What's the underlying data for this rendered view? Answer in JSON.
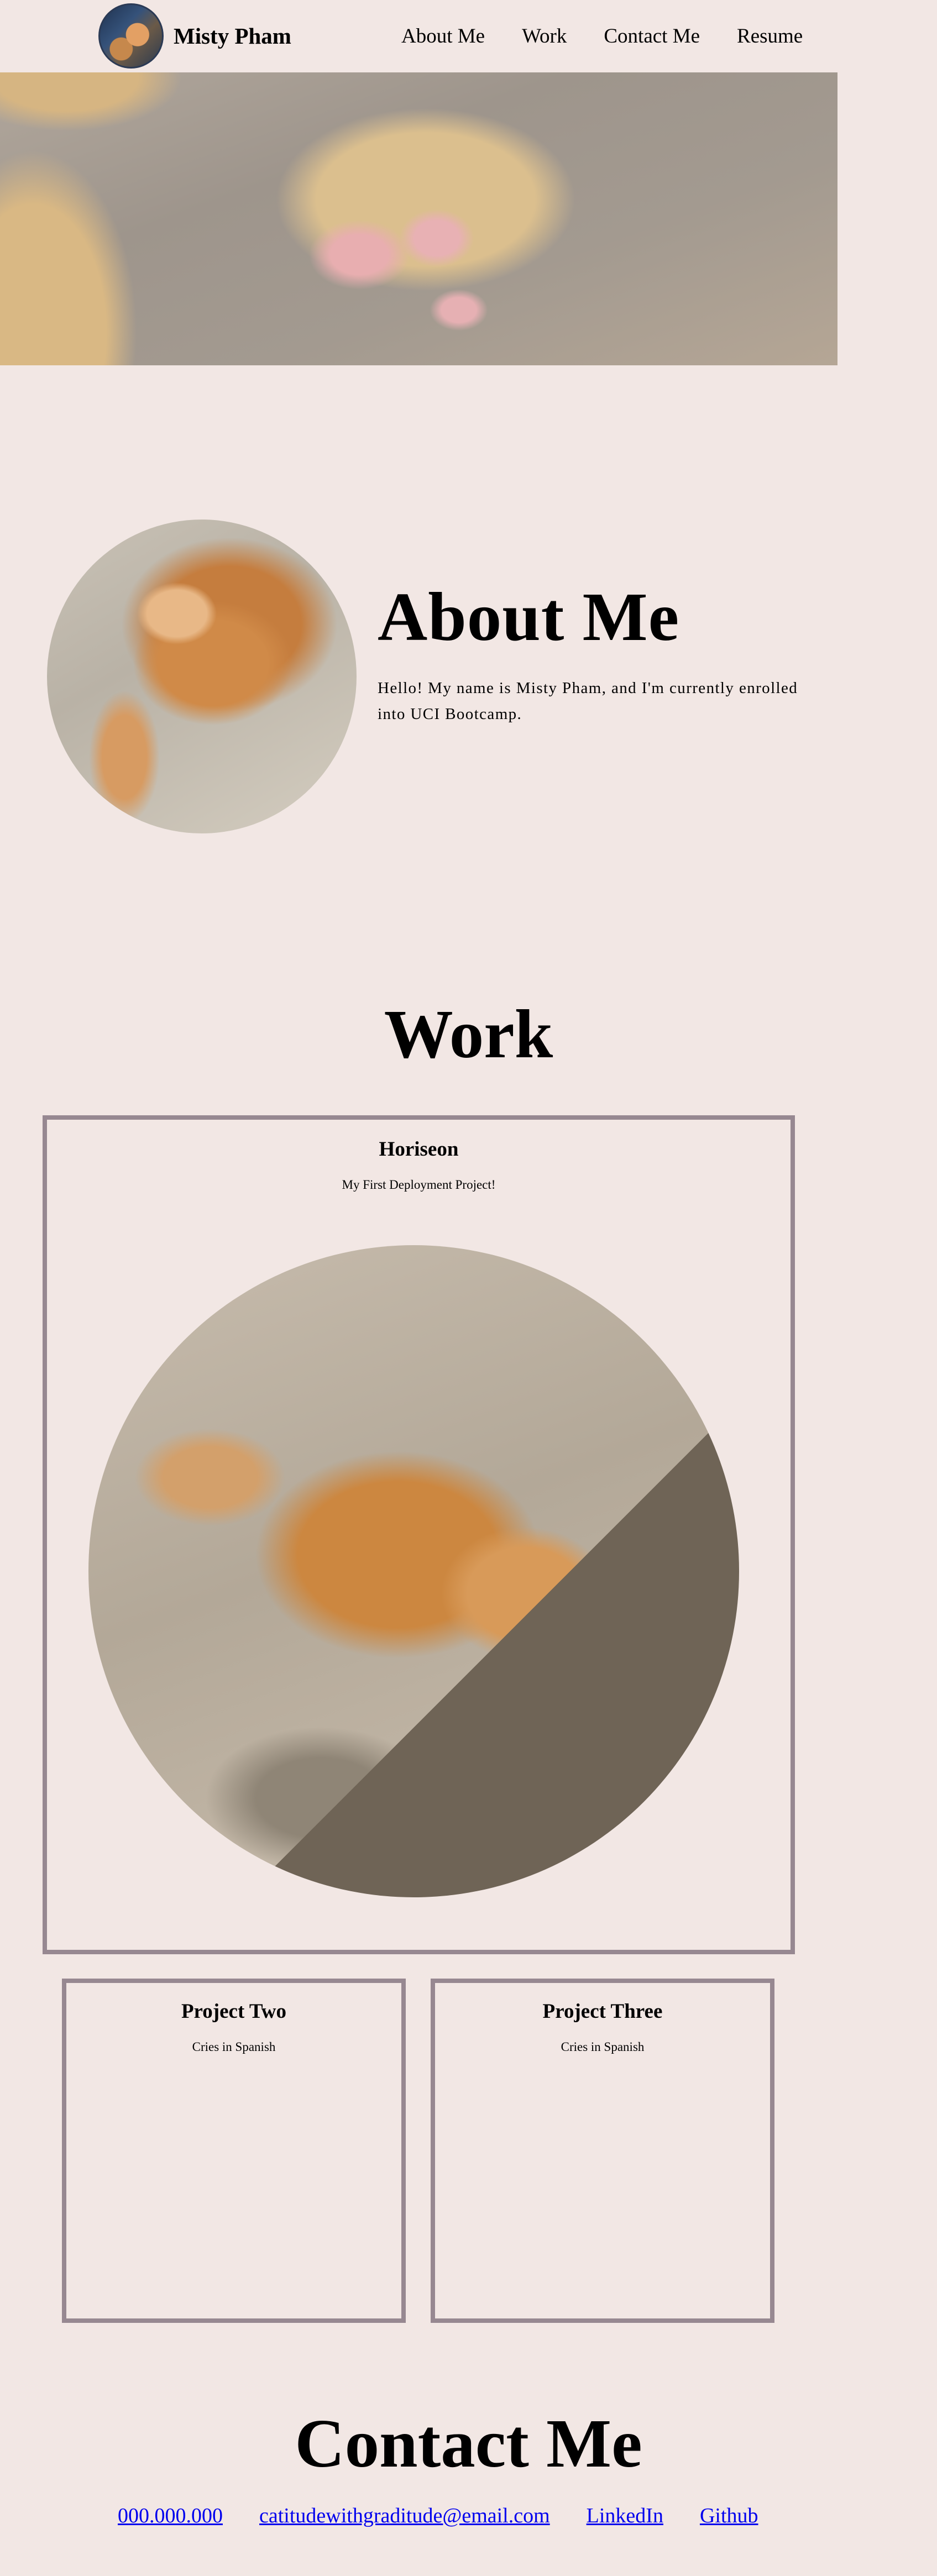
{
  "header": {
    "brand_name": "Misty Pham",
    "avatar_icon": "cat-avatar-icon",
    "nav": [
      {
        "label": "About Me"
      },
      {
        "label": "Work"
      },
      {
        "label": "Contact Me"
      },
      {
        "label": "Resume"
      }
    ]
  },
  "about": {
    "title": "About Me",
    "body": "Hello! My name is Misty Pham, and I'm currently enrolled into UCI Bootcamp."
  },
  "work": {
    "title": "Work",
    "projects": [
      {
        "title": "Horiseon",
        "description": "My First Deployment Project!"
      },
      {
        "title": "Project Two",
        "description": "Cries in Spanish"
      },
      {
        "title": "Project Three",
        "description": "Cries in Spanish"
      }
    ]
  },
  "contact": {
    "title": "Contact Me",
    "links": [
      {
        "label": "000.000.000"
      },
      {
        "label": "catitudewithgraditude@email.com"
      },
      {
        "label": "LinkedIn"
      },
      {
        "label": "Github"
      }
    ]
  },
  "colors": {
    "background": "#f2e7e4",
    "card_border": "#978891",
    "link": "#0000ee"
  }
}
